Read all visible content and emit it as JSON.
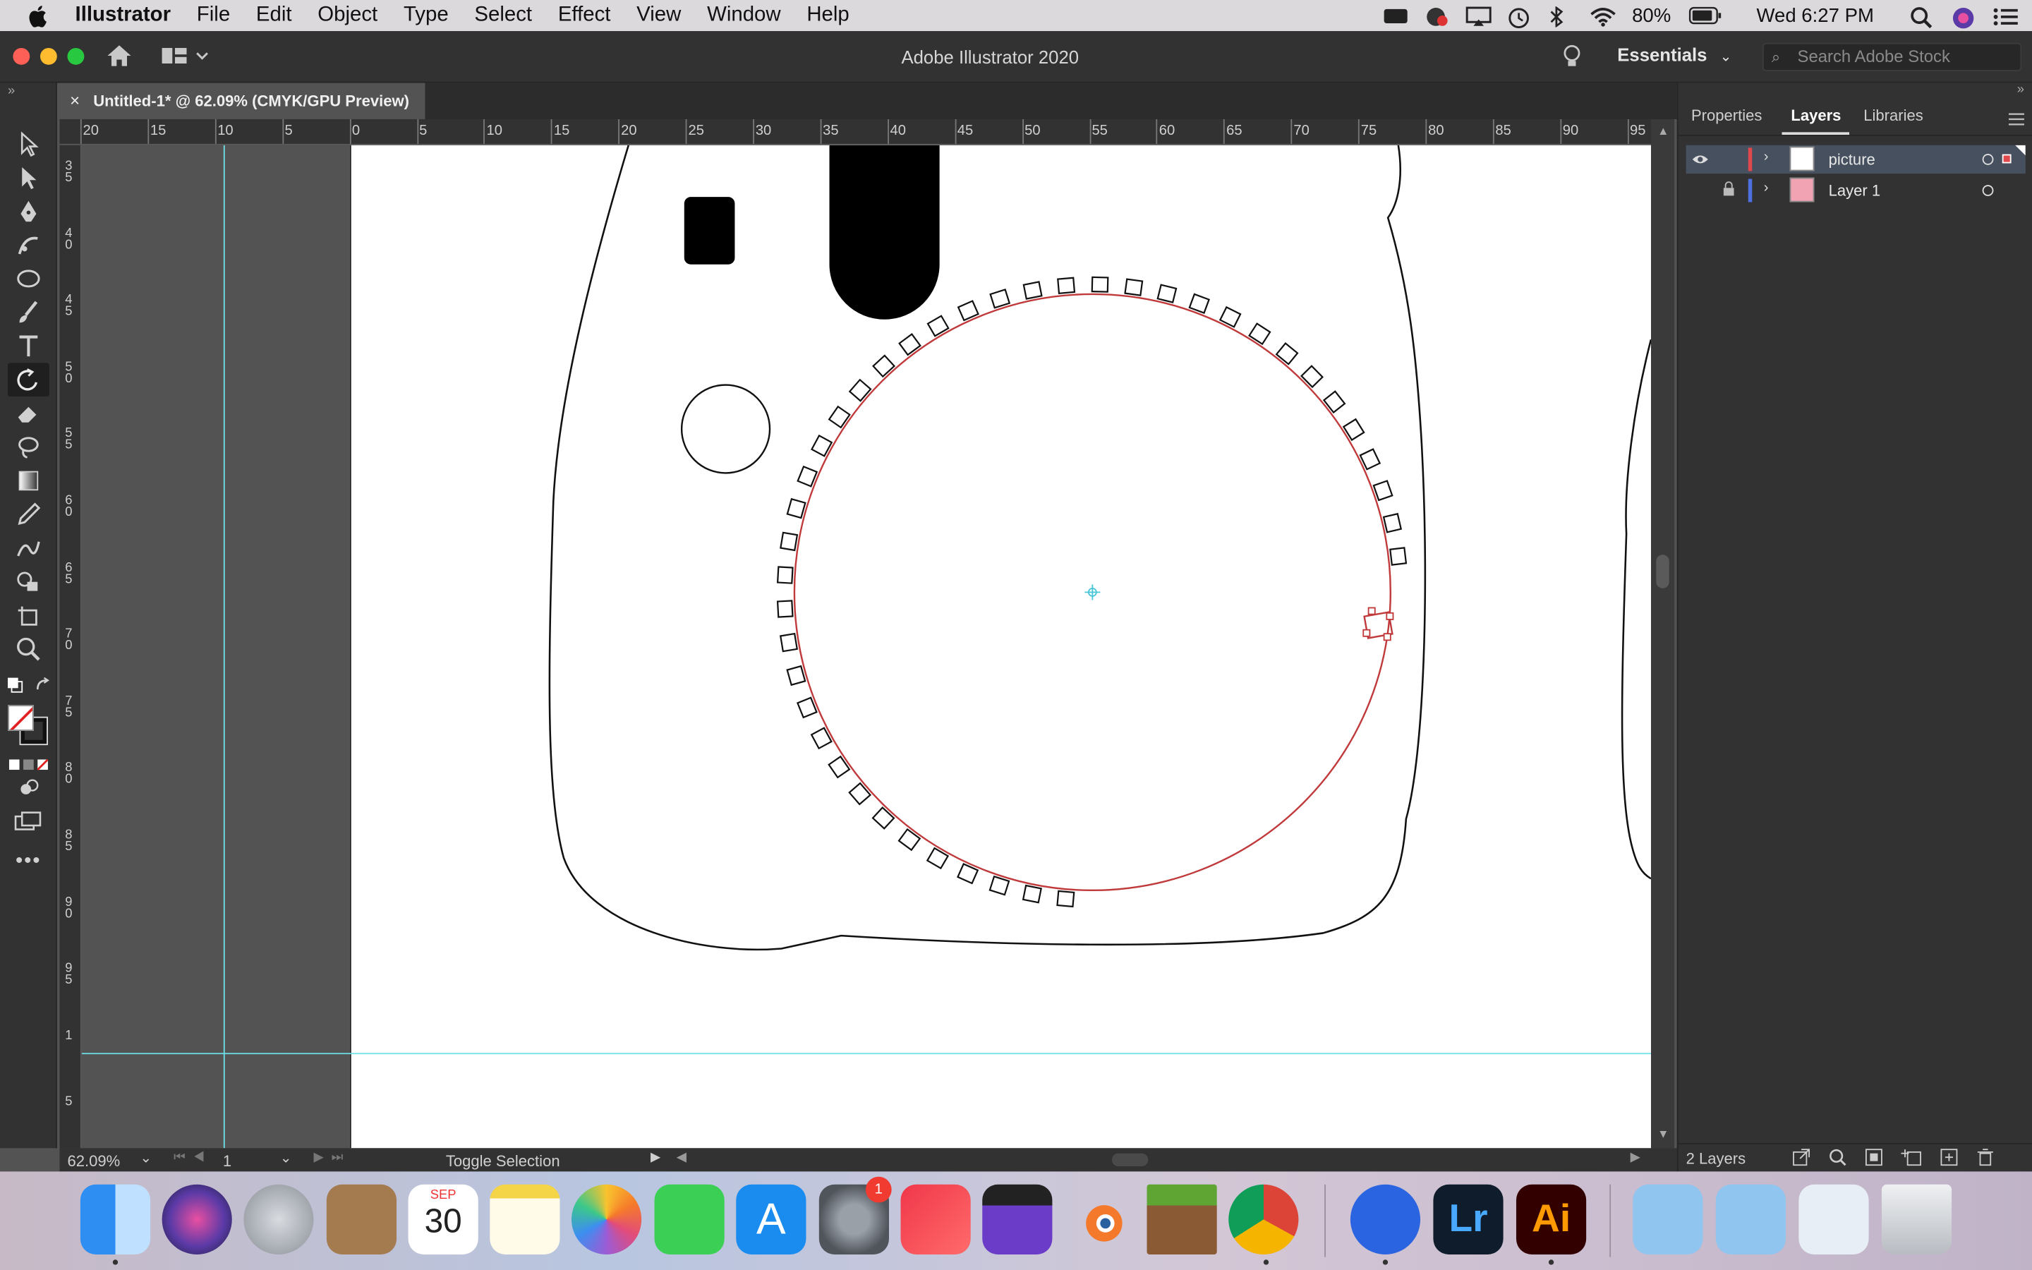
{
  "menubar": {
    "app_name": "Illustrator",
    "items": [
      "File",
      "Edit",
      "Object",
      "Type",
      "Select",
      "Effect",
      "View",
      "Window",
      "Help"
    ],
    "battery": "80%",
    "clock": "Wed 6:27 PM"
  },
  "appbar": {
    "title": "Adobe Illustrator 2020",
    "workspace": "Essentials",
    "search_placeholder": "Search Adobe Stock"
  },
  "document": {
    "tab_title": "Untitled-1* @ 62.09% (CMYK/GPU Preview)",
    "close_glyph": "×"
  },
  "rulers": {
    "horizontal": [
      "20",
      "15",
      "10",
      "5",
      "0",
      "5",
      "10",
      "15",
      "20",
      "25",
      "30",
      "35",
      "40",
      "45",
      "50",
      "55",
      "60",
      "65",
      "70",
      "75",
      "80",
      "85",
      "90",
      "95"
    ],
    "vertical": [
      [
        "3",
        "5"
      ],
      [
        "4",
        "0"
      ],
      [
        "4",
        "5"
      ],
      [
        "5",
        "0"
      ],
      [
        "5",
        "5"
      ],
      [
        "6",
        "0"
      ],
      [
        "6",
        "5"
      ],
      [
        "7",
        "0"
      ],
      [
        "7",
        "5"
      ],
      [
        "8",
        "0"
      ],
      [
        "8",
        "5"
      ],
      [
        "9",
        "0"
      ],
      [
        "9",
        "5"
      ],
      [
        "1",
        ""
      ],
      [
        "5",
        ""
      ]
    ]
  },
  "statusbar": {
    "zoom": "62.09%",
    "artboard_number": "1",
    "status_text": "Toggle Selection"
  },
  "panel": {
    "tabs": [
      "Properties",
      "Layers",
      "Libraries"
    ],
    "active_tab": "Layers",
    "layers": [
      {
        "name": "picture",
        "color": "#e0484c",
        "visible": true,
        "locked": false,
        "selected": true
      },
      {
        "name": "Layer 1",
        "color": "#4d6fe0",
        "visible": false,
        "locked": true,
        "selected": false
      }
    ],
    "layer_count": "2 Layers"
  },
  "dock": {
    "calendar_month": "SEP",
    "calendar_day": "30",
    "badge_count": "1",
    "lightroom_label": "Lr",
    "illustrator_label": "Ai"
  },
  "colors": {
    "selection": "#c0393b",
    "guide": "#6de0e8",
    "panel_bg": "#323232",
    "canvas_bg": "#535353"
  },
  "icons": {
    "tools": [
      "selection-tool-icon",
      "direct-selection-tool-icon",
      "pen-tool-icon",
      "curvature-tool-icon",
      "ellipse-tool-icon",
      "paintbrush-tool-icon",
      "type-tool-icon",
      "rotate-tool-icon",
      "eraser-tool-icon",
      "lasso-tool-icon",
      "gradient-tool-icon",
      "eyedropper-tool-icon",
      "blend-tool-icon",
      "shape-builder-icon",
      "artboard-tool-icon",
      "zoom-tool-icon"
    ]
  }
}
